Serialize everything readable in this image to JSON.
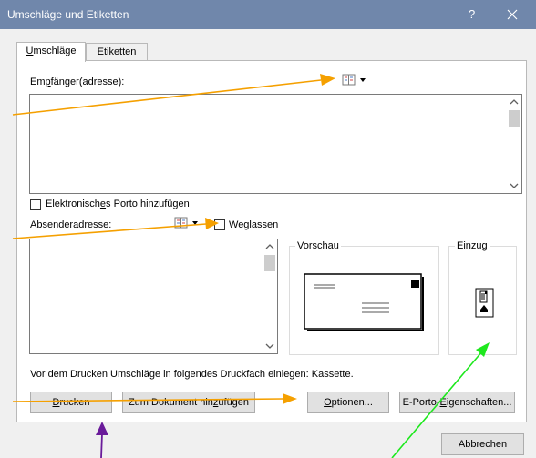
{
  "window": {
    "title": "Umschläge und Etiketten",
    "help_label": "?"
  },
  "tabs": [
    {
      "label": "Umschläge",
      "mnemonic": "U",
      "rest": "mschläge",
      "active": true
    },
    {
      "label": "Etiketten",
      "mnemonic": "E",
      "rest": "tiketten",
      "active": false
    }
  ],
  "recipient": {
    "label_pre": "Em",
    "label_mn": "p",
    "label_post": "fänger(adresse):",
    "value": ""
  },
  "postage": {
    "label_pre": "Elektronisch",
    "label_mn": "e",
    "label_post": "s Porto hinzufügen",
    "checked": false
  },
  "sender": {
    "label_mn": "A",
    "label_post": "bsenderadresse:",
    "omit_mn": "W",
    "omit_post": "eglassen",
    "omit_checked": false,
    "value": ""
  },
  "preview": {
    "title": "Vorschau"
  },
  "feed": {
    "title": "Einzug"
  },
  "instruction": "Vor dem Drucken Umschläge in folgendes Druckfach einlegen: Kassette.",
  "buttons": {
    "print_mn": "D",
    "print_post": "rucken",
    "add_pre": "Zum Dokument hin",
    "add_mn": "z",
    "add_post": "ufügen",
    "options_mn": "O",
    "options_post": "ptionen...",
    "eporto_pre": "E-Porto-",
    "eporto_mn": "E",
    "eporto_post": "igenschaften...",
    "cancel": "Abbrechen"
  },
  "annotation_colors": {
    "orange": "#f5a000",
    "green": "#1ee81e",
    "purple": "#6a1b9a"
  }
}
